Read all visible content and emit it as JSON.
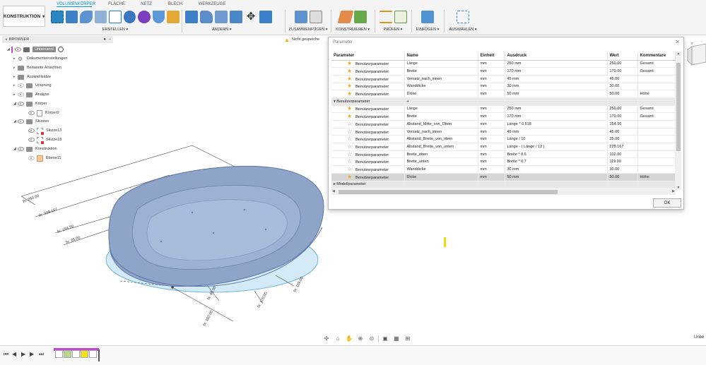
{
  "toolbar": {
    "workspace": "KONSTRUKTION",
    "tabs": [
      "VOLUMENKÖRPER",
      "FLÄCHE",
      "NETZ",
      "BLECH",
      "WERKZEUGE"
    ],
    "groups": [
      {
        "label": "ERSTELLEN ▾"
      },
      {
        "label": "ÄNDERN ▾"
      },
      {
        "label": "ZUSAMMENFÜGEN ▾"
      },
      {
        "label": "KONSTRUIEREN ▾"
      },
      {
        "label": "PRÜFEN ▾"
      },
      {
        "label": "EINFÜGEN ▾"
      },
      {
        "label": "AUSWÄHLEN ▾"
      }
    ]
  },
  "browser": {
    "title": "BROWSER",
    "root": "Unbenannt",
    "items": [
      "Dokumenteinstellungen",
      "Benannte Ansichten",
      "Auswahlsätze",
      "Ursprung",
      "Analyse",
      "Körper",
      "Körper9",
      "Skizzen",
      "Skizze13",
      "Skizze18",
      "Konstruktion",
      "Ebene11"
    ]
  },
  "warning": "Nicht gespeiche",
  "dimensions": [
    "fx: 250.00",
    "fx: 229.167",
    "fx: 154.50",
    "fx: 25.00",
    "fx: 45.00",
    "fx: 170.00",
    "fx: 119.00",
    "fx: 102.00"
  ],
  "dialog": {
    "title": "Parameter",
    "columns": [
      "Parameter",
      "Name",
      "Einheit",
      "Ausdruck",
      "Wert",
      "Kommentare"
    ],
    "rows": [
      {
        "kind": "param",
        "fav": true,
        "param": "Benutzerparameter",
        "name": "Länge",
        "unit": "mm",
        "expr": "250 mm",
        "value": "250.00",
        "comment": "Gesamt"
      },
      {
        "kind": "param",
        "fav": true,
        "param": "Benutzerparameter",
        "name": "Breite",
        "unit": "mm",
        "expr": "170 mm",
        "value": "170.00",
        "comment": "Gesamt"
      },
      {
        "kind": "param",
        "fav": true,
        "param": "Benutzerparameter",
        "name": "Versatz_nach_innen",
        "unit": "mm",
        "expr": "45 mm",
        "value": "45.00",
        "comment": ""
      },
      {
        "kind": "param",
        "fav": true,
        "param": "Benutzerparameter",
        "name": "Wanddicke",
        "unit": "mm",
        "expr": "30 mm",
        "value": "30.00",
        "comment": ""
      },
      {
        "kind": "param",
        "fav": true,
        "param": "Benutzerparameter",
        "name": "Dicke",
        "unit": "mm",
        "expr": "50 mm",
        "value": "50.00",
        "comment": "Höhe"
      },
      {
        "kind": "group",
        "param": "Benutzerparameter",
        "add": "+"
      },
      {
        "kind": "param",
        "fav": true,
        "param": "Benutzerparameter",
        "name": "Länge",
        "unit": "mm",
        "expr": "250 mm",
        "value": "250.00",
        "comment": "Gesamt"
      },
      {
        "kind": "param",
        "fav": true,
        "param": "Benutzerparameter",
        "name": "Breite",
        "unit": "mm",
        "expr": "170 mm",
        "value": "170.00",
        "comment": "Gesamt"
      },
      {
        "kind": "param",
        "fav": false,
        "param": "Benutzerparameter",
        "name": "Abstand_Mitte_von_Oben",
        "unit": "mm",
        "expr": "Länge * 0.618",
        "value": "154.50",
        "comment": ""
      },
      {
        "kind": "param",
        "fav": false,
        "param": "Benutzerparameter",
        "name": "Versatz_nach_innen",
        "unit": "mm",
        "expr": "45 mm",
        "value": "45.00",
        "comment": ""
      },
      {
        "kind": "param",
        "fav": false,
        "param": "Benutzerparameter",
        "name": "Abstand_Breite_von_oben",
        "unit": "mm",
        "expr": "Länge / 10",
        "value": "25.00",
        "comment": ""
      },
      {
        "kind": "param",
        "fav": false,
        "param": "Benutzerparameter",
        "name": "Abstand_Breite_von_unten",
        "unit": "mm",
        "expr": "Länge - ( Länge / 12 )",
        "value": "229.167",
        "comment": ""
      },
      {
        "kind": "param",
        "fav": false,
        "param": "Benutzerparameter",
        "name": "Breite_oben",
        "unit": "mm",
        "expr": "Breite * 0.6",
        "value": "102.00",
        "comment": ""
      },
      {
        "kind": "param",
        "fav": false,
        "param": "Benutzerparameter",
        "name": "Breite_unten",
        "unit": "mm",
        "expr": "Breite * 0.7",
        "value": "119.00",
        "comment": ""
      },
      {
        "kind": "param",
        "fav": false,
        "param": "Benutzerparameter",
        "name": "Wanddicke",
        "unit": "mm",
        "expr": "30 mm",
        "value": "30.00",
        "comment": ""
      },
      {
        "kind": "param",
        "fav": true,
        "selected": true,
        "param": "Benutzerparameter",
        "name": "Dicke",
        "unit": "mm",
        "expr": "50 mm",
        "value": "50.00",
        "comment": "Höhe"
      },
      {
        "kind": "group",
        "param": "Modellparameter",
        "add": ""
      }
    ],
    "ok": "OK"
  },
  "statusbar_right": "Unbe",
  "colors": {
    "accent": "#0696d7",
    "body": "#8ea4c8",
    "plane": "#cde7f5",
    "favorite": "#f1a825"
  },
  "icons": {
    "close": "close-icon",
    "favorite": "star-icon",
    "folder": "folder-icon",
    "visibility": "eye-icon",
    "warning": "warning-icon"
  }
}
